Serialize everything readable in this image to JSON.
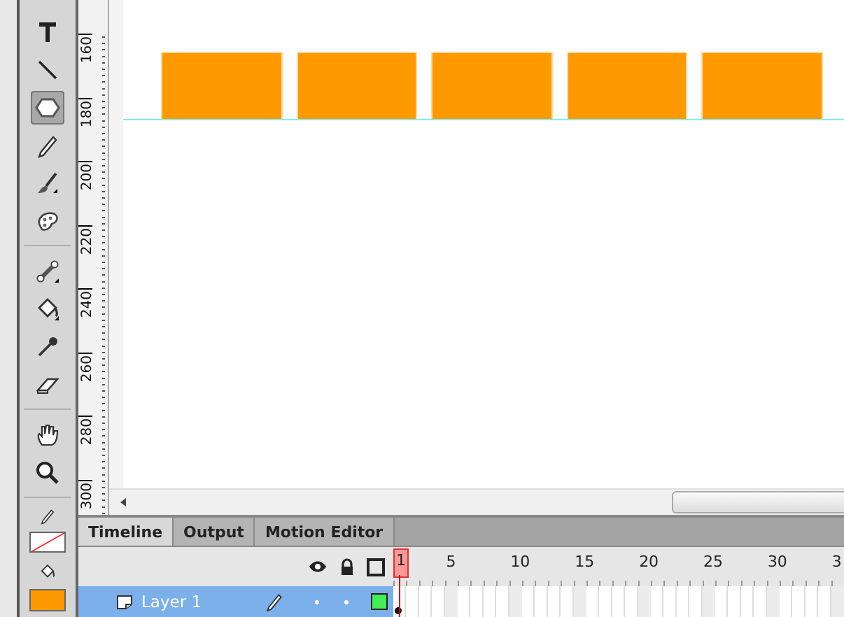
{
  "toolbox": {
    "tool_groups": [
      {
        "tools": [
          {
            "kind": "text",
            "selected": false
          },
          {
            "kind": "line",
            "selected": false
          },
          {
            "kind": "polystar",
            "selected": true
          },
          {
            "kind": "pencil",
            "selected": false
          },
          {
            "kind": "brush",
            "selected": false
          },
          {
            "kind": "deco",
            "selected": false
          }
        ]
      },
      {
        "tools": [
          {
            "kind": "bone",
            "selected": false
          },
          {
            "kind": "bucket",
            "selected": false
          },
          {
            "kind": "eyedropper",
            "selected": false
          },
          {
            "kind": "eraser",
            "selected": false
          }
        ]
      },
      {
        "tools": [
          {
            "kind": "hand",
            "selected": false
          },
          {
            "kind": "zoom",
            "selected": false
          }
        ]
      }
    ],
    "stroke_color": {
      "kind": "none"
    },
    "fill_color": {
      "kind": "solid",
      "color": "#ff9900"
    }
  },
  "vertical_ruler": {
    "labels": [
      "160",
      "180",
      "200",
      "220",
      "240",
      "260",
      "280",
      "300"
    ]
  },
  "stage": {
    "shapes": [
      {
        "kind": "rectangle"
      },
      {
        "kind": "rectangle"
      },
      {
        "kind": "rectangle"
      },
      {
        "kind": "rectangle"
      },
      {
        "kind": "rectangle"
      }
    ],
    "guides": [
      {
        "kind": "horizontal"
      }
    ]
  },
  "timeline": {
    "tabs": [
      {
        "label": "Timeline",
        "selected": true
      },
      {
        "label": "Output",
        "selected": false
      },
      {
        "label": "Motion Editor",
        "selected": false
      }
    ],
    "frame_numbers": [
      {
        "label": "1",
        "current": true
      },
      {
        "label": "5",
        "current": false
      },
      {
        "label": "10",
        "current": false
      },
      {
        "label": "15",
        "current": false
      },
      {
        "label": "20",
        "current": false
      },
      {
        "label": "25",
        "current": false
      },
      {
        "label": "30",
        "current": false
      },
      {
        "label": "3",
        "current": false
      }
    ],
    "layers": [
      {
        "name": "Layer 1",
        "selected": true,
        "editing": true,
        "hidden": false,
        "locked": false
      }
    ]
  }
}
